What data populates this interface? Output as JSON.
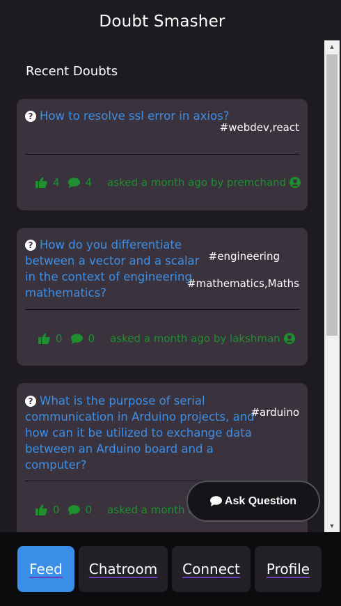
{
  "app": {
    "title": "Doubt Smasher"
  },
  "feed": {
    "section_title": "Recent Doubts",
    "doubts": [
      {
        "question": "How to resolve ssl error in axios?",
        "tags": [
          "#webdev,react"
        ],
        "likes": "4",
        "comments": "4",
        "asked": "asked a month ago by premchand"
      },
      {
        "question_lines": [
          "How do you differentiate",
          "between a vector and a scalar",
          "in the context of engineering",
          "mathematics?"
        ],
        "tags": [
          "#engineering",
          "#mathematics,Maths"
        ],
        "likes": "0",
        "comments": "0",
        "asked": "asked a month ago by lakshman"
      },
      {
        "question_lines": [
          "What is the purpose of serial",
          "communication in Arduino projects, and",
          "how can it be utilized to exchange data",
          "between an Arduino board and a",
          "computer?"
        ],
        "tags": [
          "#arduino"
        ],
        "likes": "0",
        "comments": "0",
        "asked": "asked a month ag"
      }
    ]
  },
  "actions": {
    "ask_label": "Ask Question"
  },
  "nav": {
    "items": [
      {
        "label": "Feed",
        "active": true
      },
      {
        "label": "Chatroom",
        "active": false
      },
      {
        "label": "Connect",
        "active": false
      },
      {
        "label": "Profile",
        "active": false
      }
    ]
  },
  "colors": {
    "background": "#1d1b20",
    "card": "#3a333e",
    "question": "#3d8fe6",
    "meta": "#1f8f2f",
    "active_nav": "#3b8ee8"
  }
}
